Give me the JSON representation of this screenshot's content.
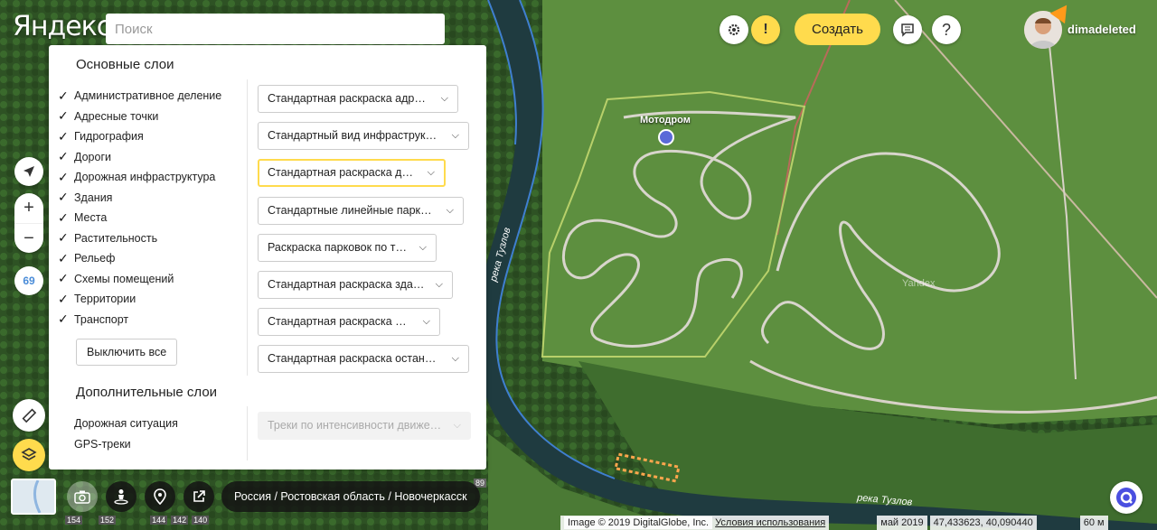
{
  "logo": "Яндекс",
  "search": {
    "placeholder": "Поиск"
  },
  "panel": {
    "main_title": "Основные слои",
    "main_layers": [
      "Административное деление",
      "Адресные точки",
      "Гидрография",
      "Дороги",
      "Дорожная инфраструктура",
      "Здания",
      "Места",
      "Растительность",
      "Рельеф",
      "Схемы помещений",
      "Территории",
      "Транспорт"
    ],
    "disable_all": "Выключить все",
    "styles": [
      "Стандартная раскраска адресов",
      "Стандартный вид инфраструктуры",
      "Стандартная раскраска дорог",
      "Стандартные линейные парковки",
      "Раскраска парковок по типу",
      "Стандартная раскраска зданий",
      "Стандартная раскраска мест",
      "Стандартная раскраска остановок"
    ],
    "extra_title": "Дополнительные слои",
    "extra_layers": [
      "Дорожная ситуация",
      "GPS-треки"
    ],
    "extra_style": "Треки по интенсивности движения"
  },
  "header": {
    "create_label": "Создать",
    "alert": "!",
    "help": "?",
    "username": "dimadeleted"
  },
  "controls": {
    "zoom_in": "+",
    "zoom_out": "−",
    "badge": "69"
  },
  "map": {
    "poi_label": "Мотодром",
    "river_label_1": "река Тузлов",
    "river_label_2": "река Тузлов",
    "watermark": "Yandex",
    "house_89": "89",
    "bottom_numbers": [
      "154",
      "152",
      "144",
      "142",
      "140"
    ]
  },
  "breadcrumb": "Россия / Ростовская область / Новочеркасск",
  "status": {
    "copyright": "Image © 2019 DigitalGlobe, Inc.",
    "terms": "Условия использования",
    "date": "май 2019",
    "coords": "47,433623, 40,090440",
    "scale": "60 м"
  },
  "colors": {
    "accent": "#ffdb4d",
    "river": "#1f3b40",
    "forest": "#2f5a24",
    "field": "#5a8a3c"
  }
}
